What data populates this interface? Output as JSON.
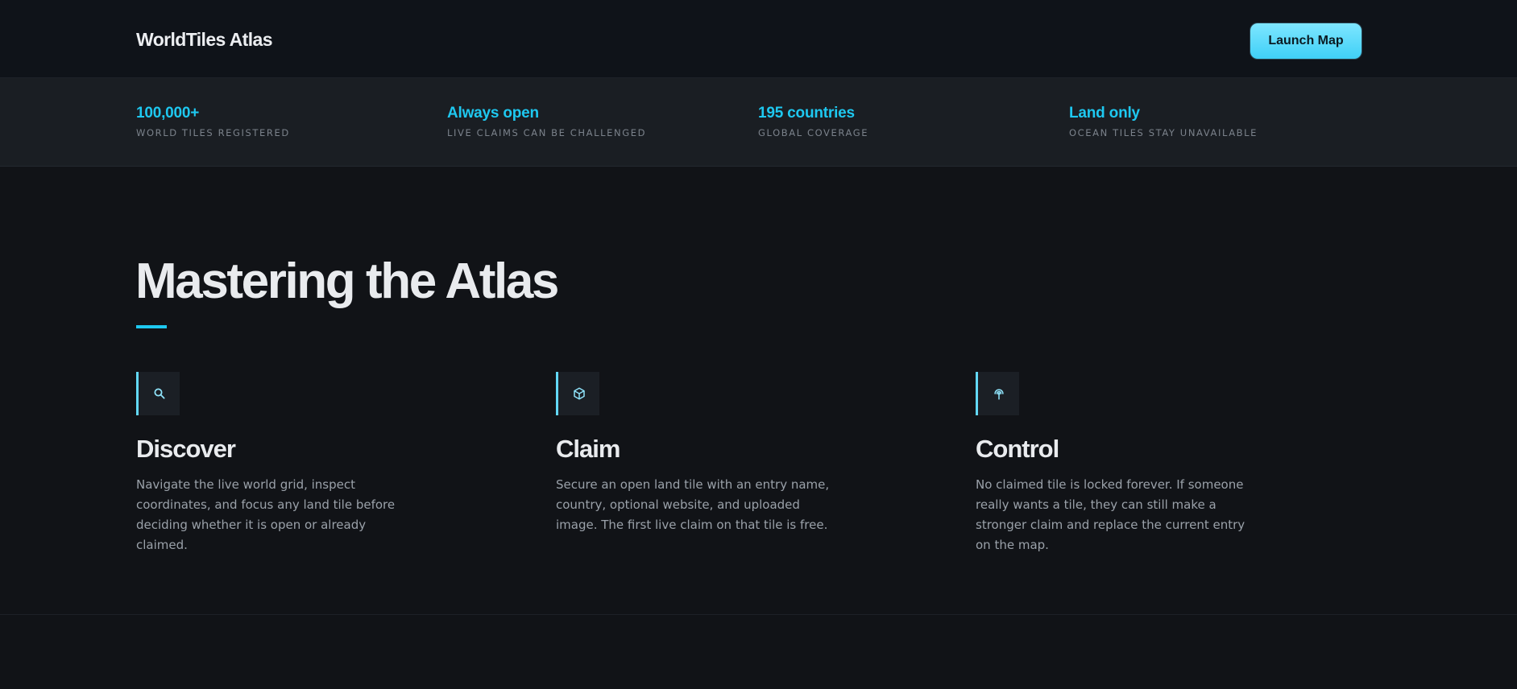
{
  "header": {
    "brand": "WorldTiles Atlas",
    "launch_label": "Launch Map"
  },
  "stats": [
    {
      "value": "100,000+",
      "label": "World tiles registered"
    },
    {
      "value": "Always open",
      "label": "Live claims can be challenged"
    },
    {
      "value": "195 countries",
      "label": "Global coverage"
    },
    {
      "value": "Land only",
      "label": "Ocean tiles stay unavailable"
    }
  ],
  "hero": {
    "title": "Mastering the Atlas"
  },
  "features": [
    {
      "icon": "search-icon",
      "title": "Discover",
      "desc": "Navigate the live world grid, inspect coordinates, and focus any land tile before deciding whether it is open or already claimed."
    },
    {
      "icon": "cube-icon",
      "title": "Claim",
      "desc": "Secure an open land tile with an entry name, country, optional website, and uploaded image. The first live claim on that tile is free."
    },
    {
      "icon": "broadcast-icon",
      "title": "Control",
      "desc": "No claimed tile is locked forever. If someone really wants a tile, they can still make a stronger claim and replace the current entry on the map."
    }
  ],
  "colors": {
    "accent": "#1ec8f0",
    "background": "#111317",
    "header_bg": "#0f1319",
    "stats_bg": "#1a1e23"
  }
}
